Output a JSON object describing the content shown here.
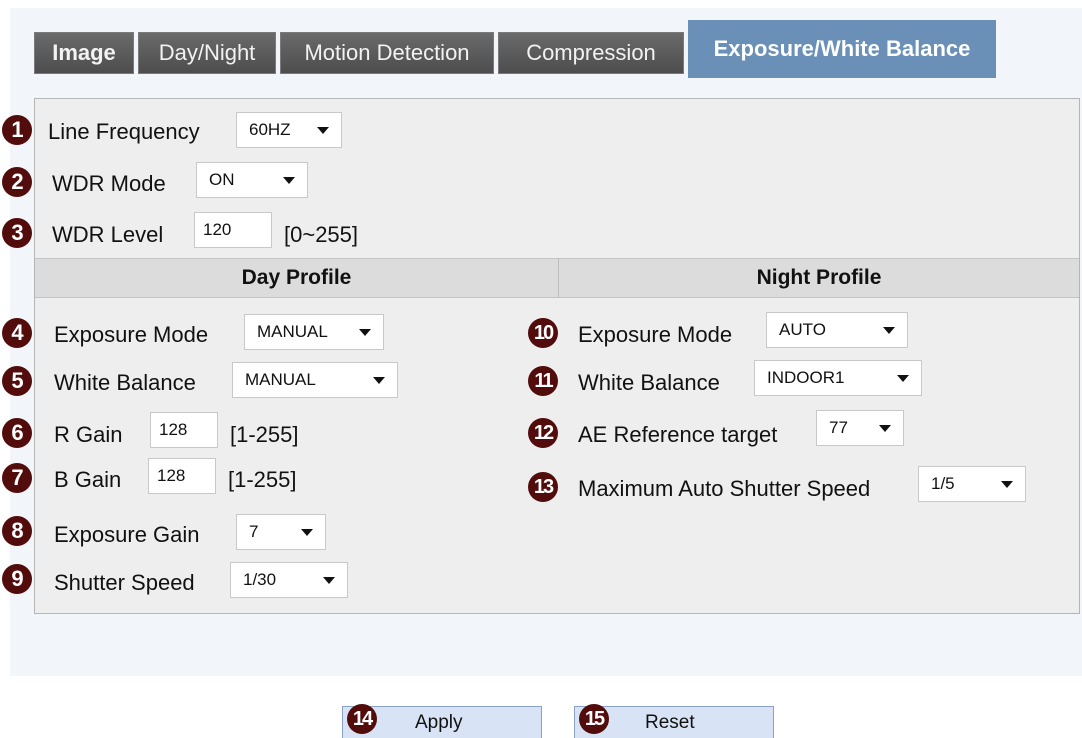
{
  "tabs": [
    {
      "label": "Image"
    },
    {
      "label": "Day/Night"
    },
    {
      "label": "Motion Detection"
    },
    {
      "label": "Compression"
    },
    {
      "label": "Exposure/White Balance"
    }
  ],
  "general": {
    "line_frequency": {
      "num": "1",
      "label": "Line Frequency",
      "value": "60HZ"
    },
    "wdr_mode": {
      "num": "2",
      "label": "WDR Mode",
      "value": "ON"
    },
    "wdr_level": {
      "num": "3",
      "label": "WDR Level",
      "value": "120",
      "range": "[0~255]"
    }
  },
  "day_profile": {
    "header": "Day Profile",
    "exposure_mode": {
      "num": "4",
      "label": "Exposure Mode",
      "value": "MANUAL"
    },
    "white_balance": {
      "num": "5",
      "label": "White Balance",
      "value": "MANUAL"
    },
    "r_gain": {
      "num": "6",
      "label": "R Gain",
      "value": "128",
      "range": "[1-255]"
    },
    "b_gain": {
      "num": "7",
      "label": "B Gain",
      "value": "128",
      "range": "[1-255]"
    },
    "exposure_gain": {
      "num": "8",
      "label": "Exposure Gain",
      "value": "7"
    },
    "shutter_speed": {
      "num": "9",
      "label": "Shutter Speed",
      "value": "1/30"
    }
  },
  "night_profile": {
    "header": "Night Profile",
    "exposure_mode": {
      "num": "10",
      "label": "Exposure Mode",
      "value": "AUTO"
    },
    "white_balance": {
      "num": "11",
      "label": "White Balance",
      "value": "INDOOR1"
    },
    "ae_reference": {
      "num": "12",
      "label": "AE Reference target",
      "value": "77"
    },
    "max_shutter": {
      "num": "13",
      "label": "Maximum Auto Shutter Speed",
      "value": "1/5"
    }
  },
  "buttons": {
    "apply": {
      "num": "14",
      "label": "Apply"
    },
    "reset": {
      "num": "15",
      "label": "Reset"
    }
  },
  "colors": {
    "badge": "#520c0c",
    "active_tab": "#6a90b8",
    "tab": "#5a5a5a"
  }
}
